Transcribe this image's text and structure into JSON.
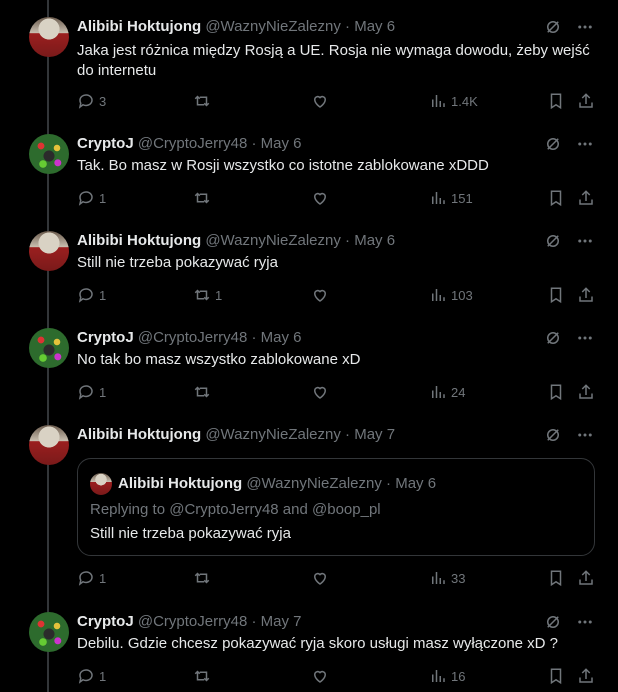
{
  "tweets": [
    {
      "name": "Alibibi Hoktujong",
      "handle": "@WaznyNieZalezny",
      "sep": "·",
      "date": "May 6",
      "text": "Jaka jest różnica między Rosją a UE. Rosja nie wymaga dowodu, żeby wejść do internetu",
      "replies": "3",
      "retweets": "",
      "likes": "",
      "views": "1.4K"
    },
    {
      "name": "CryptoJ",
      "handle": "@CryptoJerry48",
      "sep": "·",
      "date": "May 6",
      "text": "Tak. Bo masz w Rosji wszystko co istotne zablokowane xDDD",
      "replies": "1",
      "retweets": "",
      "likes": "",
      "views": "151"
    },
    {
      "name": "Alibibi Hoktujong",
      "handle": "@WaznyNieZalezny",
      "sep": "·",
      "date": "May 6",
      "text": "Still nie trzeba pokazywać ryja",
      "replies": "1",
      "retweets": "1",
      "likes": "",
      "views": "103"
    },
    {
      "name": "CryptoJ",
      "handle": "@CryptoJerry48",
      "sep": "·",
      "date": "May 6",
      "text": "No tak bo masz wszystko zablokowane xD",
      "replies": "1",
      "retweets": "",
      "likes": "",
      "views": "24"
    },
    {
      "name": "Alibibi Hoktujong",
      "handle": "@WaznyNieZalezny",
      "sep": "·",
      "date": "May 7",
      "text": "",
      "replies": "1",
      "retweets": "",
      "likes": "",
      "views": "33"
    },
    {
      "name": "CryptoJ",
      "handle": "@CryptoJerry48",
      "sep": "·",
      "date": "May 7",
      "text": "Debilu. Gdzie chcesz pokazywać ryja skoro usługi masz wyłączone xD ?",
      "replies": "1",
      "retweets": "",
      "likes": "",
      "views": "16"
    }
  ],
  "quote": {
    "name": "Alibibi Hoktujong",
    "handle": "@WaznyNieZalezny",
    "sep": "·",
    "date": "May 6",
    "reply_prefix": "Replying to",
    "reply_users": "@CryptoJerry48 and @boop_pl",
    "text": "Still nie trzeba pokazywać ryja"
  },
  "icons": [
    "grok-icon",
    "more-icon",
    "reply-icon",
    "retweet-icon",
    "like-icon",
    "views-icon",
    "bookmark-icon",
    "share-icon"
  ]
}
